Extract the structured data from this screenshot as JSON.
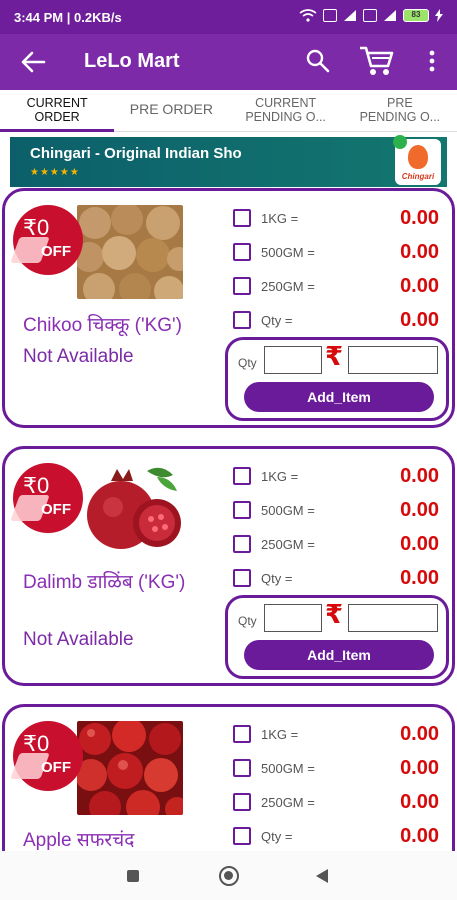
{
  "status_bar": {
    "time": "3:44 PM | 0.2KB/s",
    "battery": "83"
  },
  "app_bar": {
    "title": "LeLo Mart",
    "icons": [
      "back-arrow-icon",
      "search-icon",
      "cart-icon",
      "more-vert-icon"
    ]
  },
  "tabs": [
    {
      "line1": "CURRENT",
      "line2": "ORDER",
      "active": true
    },
    {
      "line1": "PRE ORDER",
      "line2": "",
      "active": false
    },
    {
      "line1": "CURRENT",
      "line2": "PENDING O...",
      "active": false
    },
    {
      "line1": "PRE",
      "line2": "PENDING O...",
      "active": false
    }
  ],
  "ad_banner": {
    "title": "Chingari - Original Indian Sho",
    "stars": "★★★★★",
    "logo_text": "Chingari"
  },
  "common": {
    "discount_amount": "₹0",
    "discount_off": "OFF",
    "qty_label": "Qty",
    "rupee_symbol": "₹",
    "add_button": "Add_Item",
    "option_labels": [
      "1KG =",
      "500GM =",
      "250GM =",
      "Qty ="
    ]
  },
  "products": [
    {
      "name": "Chikoo चिक्कू ('KG')",
      "status": "Not Available",
      "image": "chikoo-fruit-image",
      "prices": [
        "0.00",
        "0.00",
        "0.00",
        "0.00"
      ]
    },
    {
      "name": "Dalimb डाळिंब ('KG')",
      "status": "Not Available",
      "image": "pomegranate-image",
      "prices": [
        "0.00",
        "0.00",
        "0.00",
        "0.00"
      ]
    },
    {
      "name": "Apple सफरचंद",
      "status": "",
      "image": "apple-image",
      "prices": [
        "0.00",
        "0.00",
        "0.00",
        "0.00"
      ]
    }
  ],
  "colors": {
    "primary": "#7c2aa8",
    "accent": "#6a1b9a",
    "price_red": "#d60a0a",
    "discount_red": "#c8102e"
  }
}
